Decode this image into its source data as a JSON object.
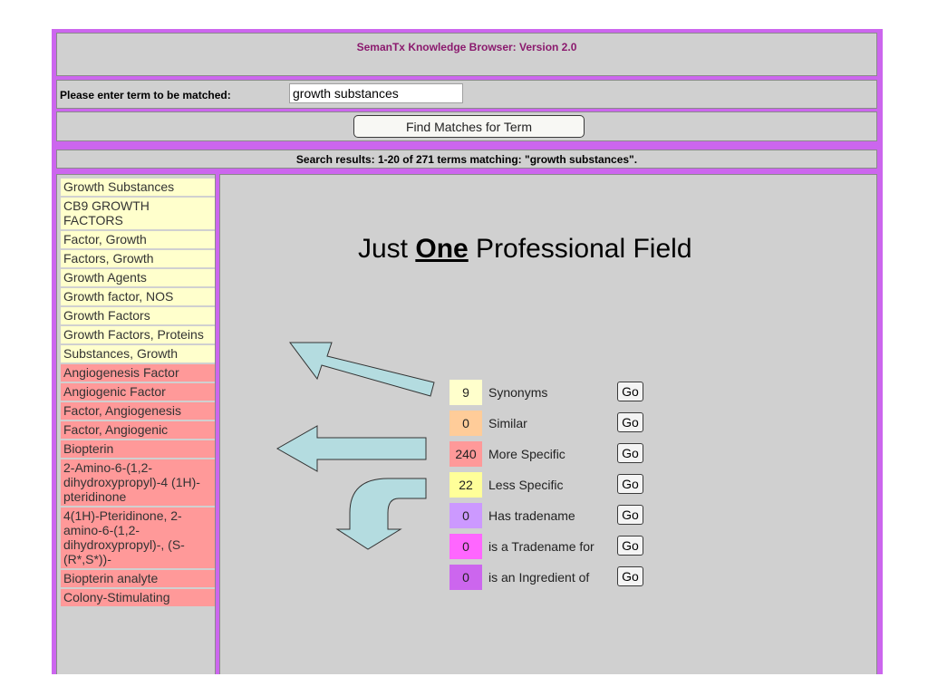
{
  "colors": {
    "frame": "#cc66ee",
    "panel": "#d0d0d0",
    "title_text": "#8b1a6e",
    "yellow_item": "#ffffcc",
    "pink_item": "#ff9999",
    "arrow_fill": "#b4dce0"
  },
  "header": {
    "title": "SemanTx Knowledge Browser: Version 2.0"
  },
  "search": {
    "label": "Please enter term to be matched:",
    "value": "growth substances",
    "button_label": "Find Matches for Term"
  },
  "results": {
    "summary": "Search results: 1-20 of 271 terms matching: \"growth substances\"."
  },
  "terms": [
    {
      "label": "Growth Substances",
      "color": "yellow"
    },
    {
      "label": "CB9 GROWTH FACTORS",
      "color": "yellow"
    },
    {
      "label": "Factor, Growth",
      "color": "yellow"
    },
    {
      "label": "Factors, Growth",
      "color": "yellow"
    },
    {
      "label": "Growth Agents",
      "color": "yellow"
    },
    {
      "label": "Growth factor, NOS",
      "color": "yellow"
    },
    {
      "label": "Growth Factors",
      "color": "yellow"
    },
    {
      "label": "Growth Factors, Proteins",
      "color": "yellow"
    },
    {
      "label": "Substances, Growth",
      "color": "yellow"
    },
    {
      "label": "Angiogenesis Factor",
      "color": "pink"
    },
    {
      "label": "Angiogenic Factor",
      "color": "pink"
    },
    {
      "label": "Factor, Angiogenesis",
      "color": "pink"
    },
    {
      "label": "Factor, Angiogenic",
      "color": "pink"
    },
    {
      "label": "Biopterin",
      "color": "pink"
    },
    {
      "label": "2-Amino-6-(1,2-dihydroxypropyl)-4 (1H)-pteridinone",
      "color": "pink"
    },
    {
      "label": "4(1H)-Pteridinone, 2-amino-6-(1,2-dihydroxypropyl)-, (S-(R*,S*))-",
      "color": "pink"
    },
    {
      "label": "Biopterin analyte",
      "color": "pink"
    },
    {
      "label": "Colony-Stimulating",
      "color": "pink"
    }
  ],
  "headline": {
    "prefix": "Just ",
    "emphasis": "One",
    "suffix": " Professional Field"
  },
  "categories": [
    {
      "count": "9",
      "label": "Synonyms",
      "go": "Go",
      "color": "#ffffcc"
    },
    {
      "count": "0",
      "label": "Similar",
      "go": "Go",
      "color": "#ffcc99"
    },
    {
      "count": "240",
      "label": "More Specific",
      "go": "Go",
      "color": "#ff9999"
    },
    {
      "count": "22",
      "label": "Less Specific",
      "go": "Go",
      "color": "#ffff99"
    },
    {
      "count": "0",
      "label": "Has tradename",
      "go": "Go",
      "color": "#cc99ff"
    },
    {
      "count": "0",
      "label": "is a Tradename for",
      "go": "Go",
      "color": "#ff66ff"
    },
    {
      "count": "0",
      "label": "is an Ingredient of",
      "go": "Go",
      "color": "#cc66ee"
    }
  ]
}
